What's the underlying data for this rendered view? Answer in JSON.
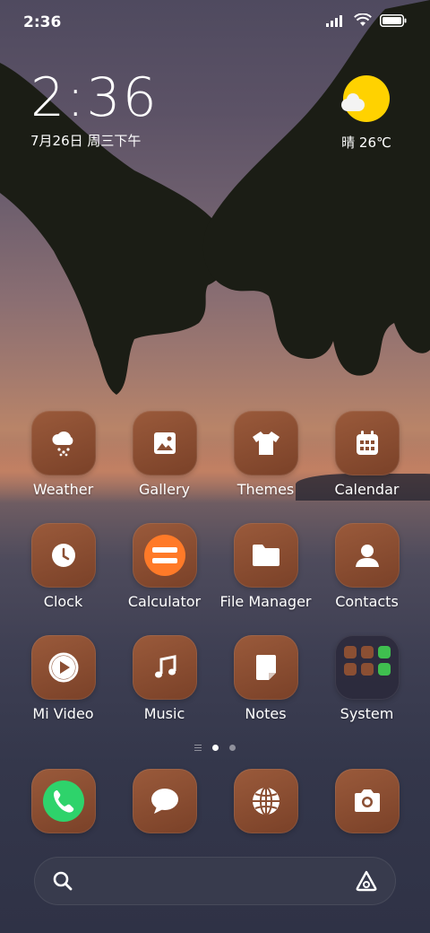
{
  "status_bar": {
    "time": "2:36"
  },
  "clock_widget": {
    "time": "2:36",
    "date": "7月26日 周三下午"
  },
  "weather_widget": {
    "condition_temp": "晴 26℃",
    "icon": "sun-cloud-icon"
  },
  "apps": [
    {
      "label": "Weather",
      "icon": "weather-icon"
    },
    {
      "label": "Gallery",
      "icon": "gallery-icon"
    },
    {
      "label": "Themes",
      "icon": "themes-icon"
    },
    {
      "label": "Calendar",
      "icon": "calendar-icon"
    },
    {
      "label": "Clock",
      "icon": "clock-icon"
    },
    {
      "label": "Calculator",
      "icon": "calculator-icon"
    },
    {
      "label": "File Manager",
      "icon": "folder-icon"
    },
    {
      "label": "Contacts",
      "icon": "contacts-icon"
    },
    {
      "label": "Mi Video",
      "icon": "play-icon"
    },
    {
      "label": "Music",
      "icon": "music-icon"
    },
    {
      "label": "Notes",
      "icon": "notes-icon"
    },
    {
      "label": "System",
      "icon": "system-folder-icon"
    }
  ],
  "dock": [
    {
      "icon": "phone-icon"
    },
    {
      "icon": "messages-icon"
    },
    {
      "icon": "browser-icon"
    },
    {
      "icon": "camera-icon"
    }
  ],
  "page_indicator": {
    "pages": 2,
    "current": 1
  },
  "search_bar": {
    "icon": "search-icon",
    "assistant_icon": "assistant-icon"
  },
  "colors": {
    "icon_bg": "#8b4f33",
    "calculator_accent": "#ff7a28",
    "phone_accent": "#2ed36b",
    "sun": "#ffd200"
  }
}
